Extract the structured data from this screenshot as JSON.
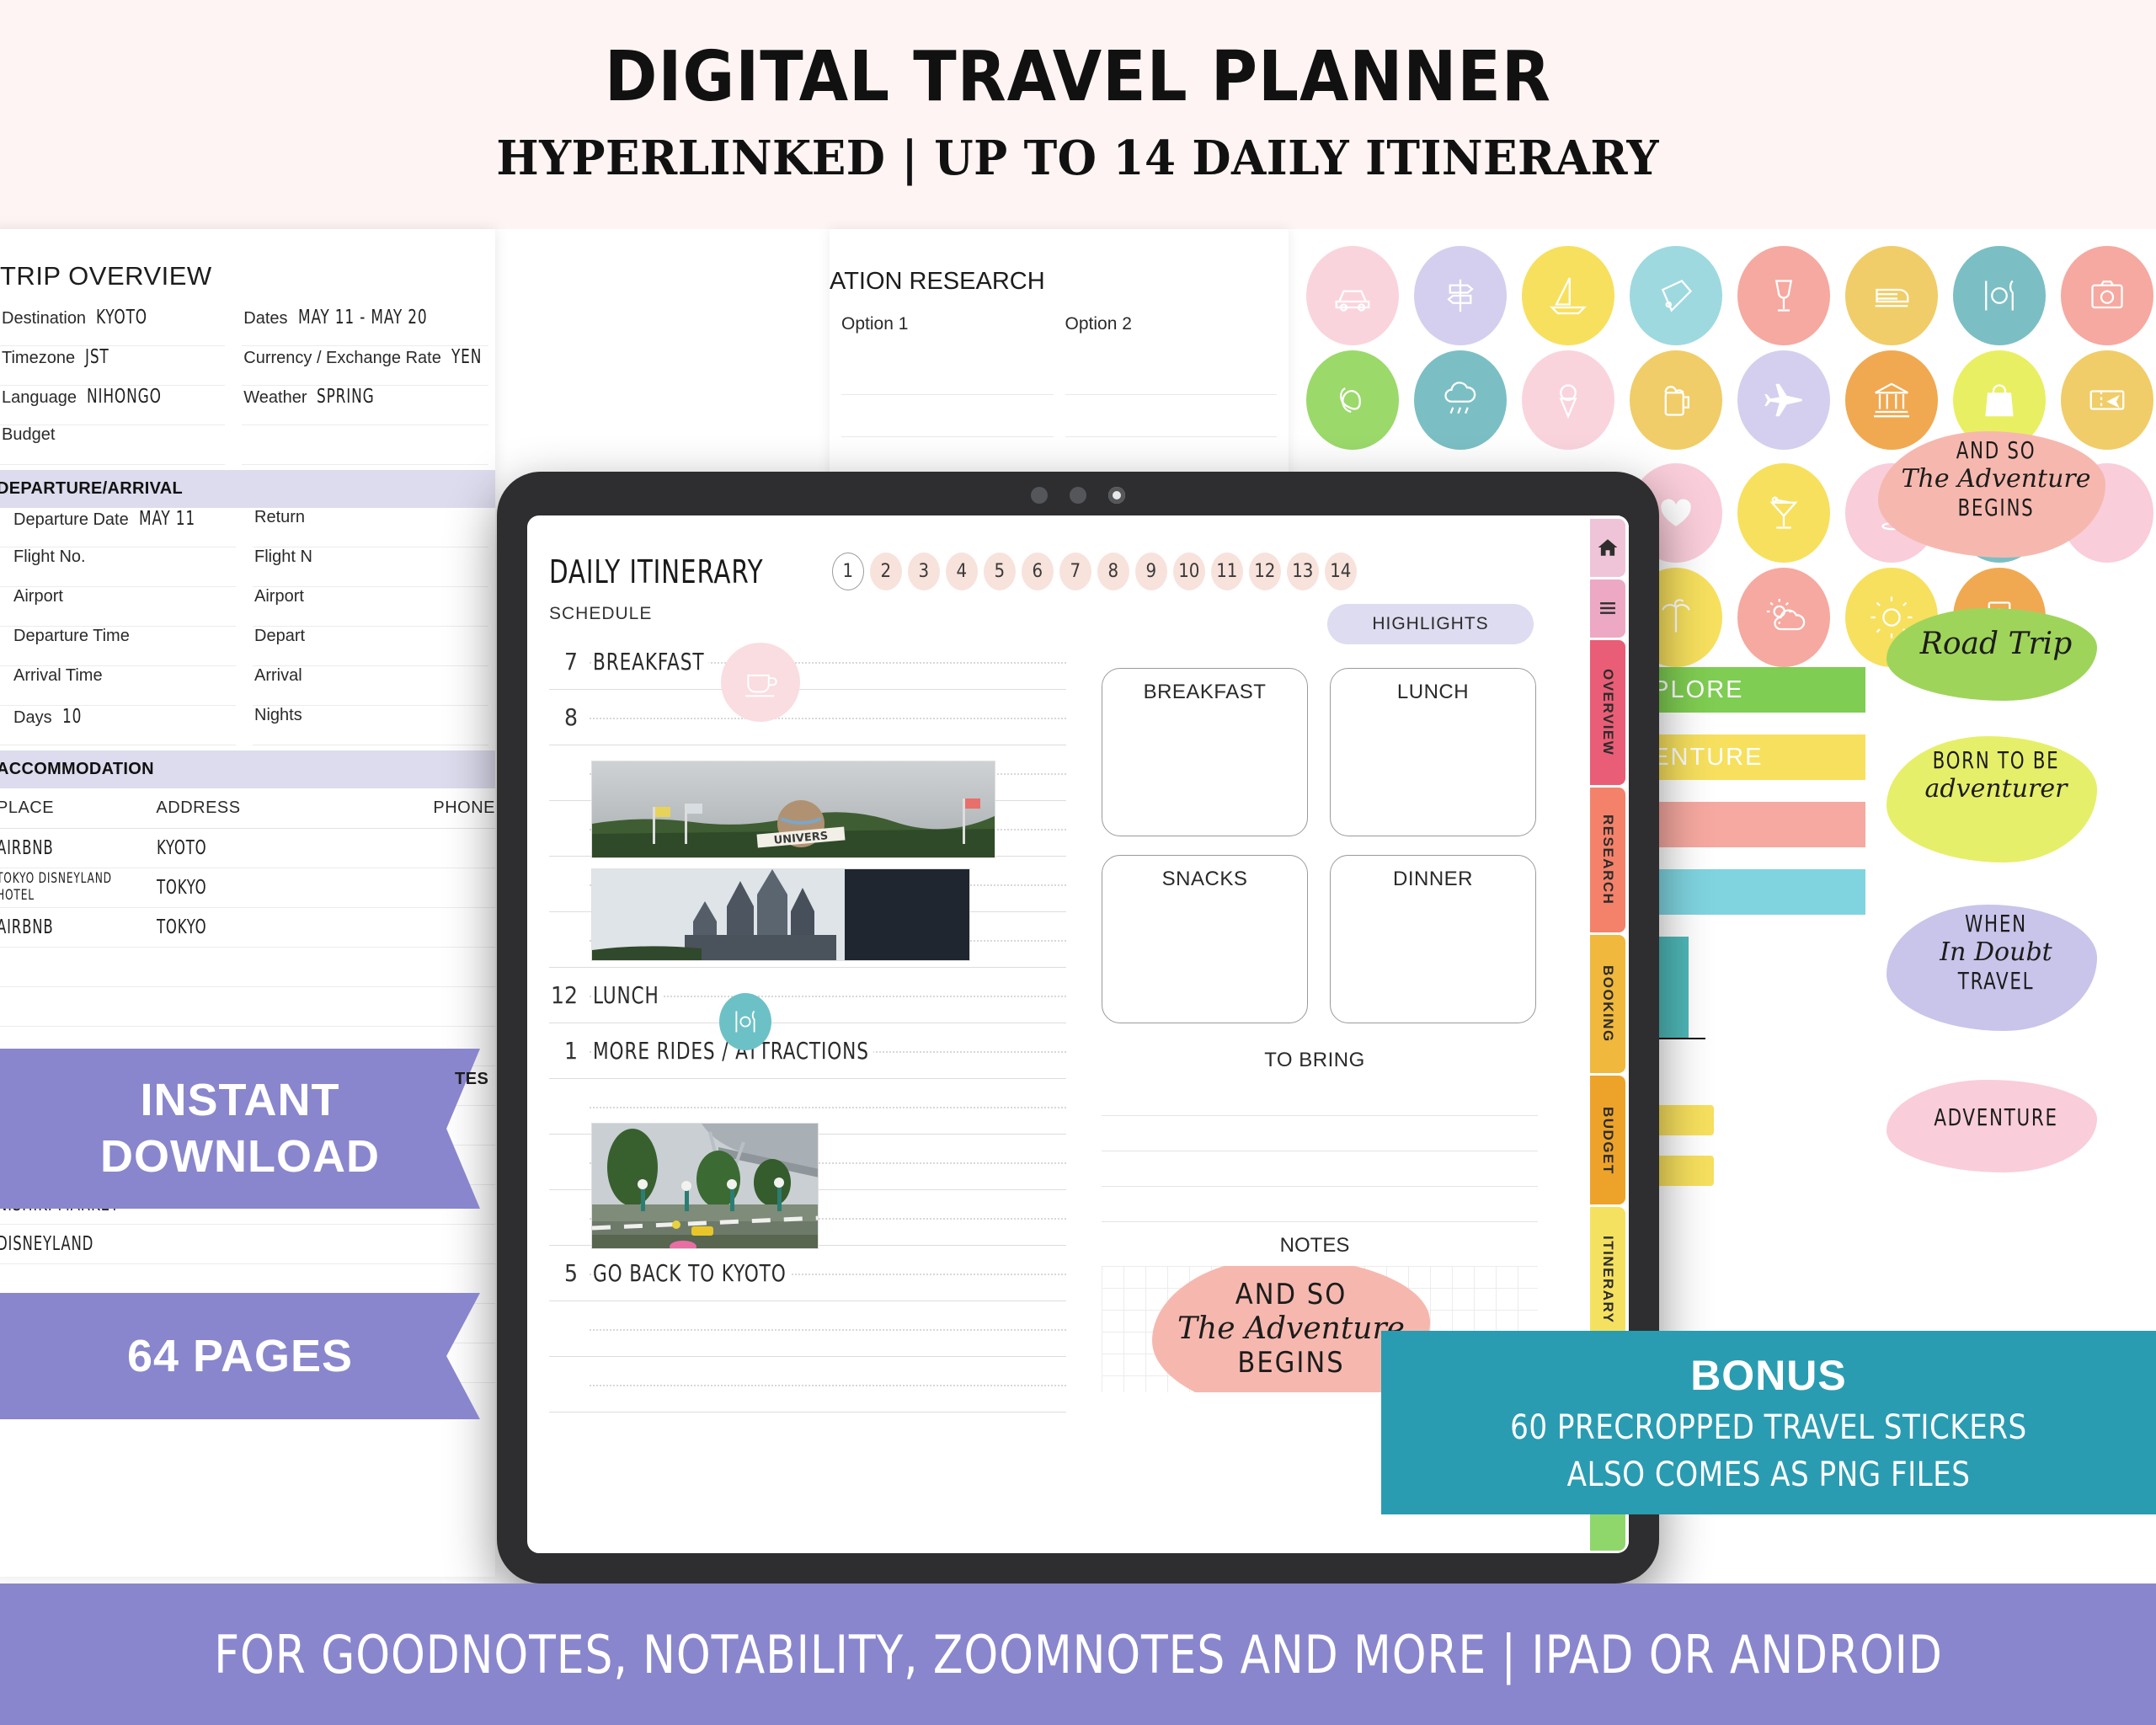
{
  "header": {
    "title": "DIGITAL TRAVEL PLANNER",
    "subtitle": "HYPERLINKED | UP TO 14 DAILY ITINERARY"
  },
  "trip_overview": {
    "title": "TRIP OVERVIEW",
    "left_fields": [
      {
        "label": "Destination",
        "value": "KYOTO"
      },
      {
        "label": "Timezone",
        "value": "JST"
      },
      {
        "label": "Language",
        "value": "NIHONGO"
      },
      {
        "label": "Budget",
        "value": ""
      }
    ],
    "right_fields": [
      {
        "label": "Dates",
        "value": "MAY 11 - MAY 20"
      },
      {
        "label": "Currency / Exchange Rate",
        "value": "YEN"
      },
      {
        "label": "Weather",
        "value": "SPRING"
      },
      {
        "label": "",
        "value": ""
      }
    ],
    "departure_section": "DEPARTURE/ARRIVAL",
    "departure_left": [
      {
        "label": "Departure Date",
        "value": "MAY 11"
      },
      {
        "label": "Flight No.",
        "value": ""
      },
      {
        "label": "Airport",
        "value": ""
      },
      {
        "label": "Departure Time",
        "value": ""
      },
      {
        "label": "Arrival Time",
        "value": ""
      },
      {
        "label": "Days",
        "value": "10"
      }
    ],
    "departure_right": [
      {
        "label": "Return",
        "value": ""
      },
      {
        "label": "Flight N",
        "value": ""
      },
      {
        "label": "Airport",
        "value": ""
      },
      {
        "label": "Depart",
        "value": ""
      },
      {
        "label": "Arrival",
        "value": ""
      },
      {
        "label": "Nights",
        "value": ""
      }
    ],
    "accommodation_section": "ACCOMMODATION",
    "accommodation_headers": [
      "PLACE",
      "ADDRESS",
      "PHONE"
    ],
    "accommodation_rows": [
      {
        "place": "AIRBNB",
        "address": "KYOTO",
        "phone": ""
      },
      {
        "place": "TOKYO DISNEYLAND HOTEL",
        "address": "TOKYO",
        "phone": ""
      },
      {
        "place": "AIRBNB",
        "address": "TOKYO",
        "phone": ""
      }
    ],
    "places_rows": [
      {
        "name": "NISHIKI MARKET"
      },
      {
        "name": "DISNEYLAND"
      }
    ],
    "notes_col_label": "TES"
  },
  "destination_research": {
    "title_visible": "ATION RESEARCH",
    "option1": "Option 1",
    "option2": "Option 2"
  },
  "tablet": {
    "page_title": "DAILY ITINERARY",
    "page_numbers": [
      "1",
      "2",
      "3",
      "4",
      "5",
      "6",
      "7",
      "8",
      "9",
      "10",
      "11",
      "12",
      "13",
      "14"
    ],
    "active_page": "1",
    "schedule_label": "SCHEDULE",
    "schedule_rows": [
      {
        "hour": "7",
        "text": "BREAKFAST",
        "sticker": "coffee-cup-icon"
      },
      {
        "hour": "8",
        "text": "",
        "sticker": ""
      },
      {
        "hour": "",
        "text": "",
        "sticker": ""
      },
      {
        "hour": "",
        "text": "",
        "sticker": ""
      },
      {
        "hour": "12",
        "text": "LUNCH",
        "sticker": "cutlery-icon"
      },
      {
        "hour": "1",
        "text": "MORE RIDES / ATTRACTIONS",
        "sticker": ""
      },
      {
        "hour": "",
        "text": "",
        "sticker": ""
      },
      {
        "hour": "",
        "text": "",
        "sticker": ""
      },
      {
        "hour": "5",
        "text": "GO BACK TO KYOTO",
        "sticker": ""
      },
      {
        "hour": "",
        "text": "",
        "sticker": ""
      },
      {
        "hour": "",
        "text": "",
        "sticker": ""
      }
    ],
    "highlights_pill": "HIGHLIGHTS",
    "meal_boxes": [
      "BREAKFAST",
      "LUNCH",
      "SNACKS",
      "DINNER"
    ],
    "to_bring_title": "TO BRING",
    "notes_title": "NOTES",
    "notes_quote": {
      "line1": "AND SO",
      "line2": "The Adventure",
      "line3": "BEGINS"
    },
    "side_tabs": [
      {
        "label": "",
        "icon": "home-icon",
        "color": "#f0c4d8"
      },
      {
        "label": "",
        "icon": "menu-icon",
        "color": "#eda8c4"
      },
      {
        "label": "OVERVIEW",
        "icon": "",
        "color": "#ea5d76"
      },
      {
        "label": "RESEARCH",
        "icon": "",
        "color": "#f4826a"
      },
      {
        "label": "BOOKING",
        "icon": "",
        "color": "#f0b83c"
      },
      {
        "label": "BUDGET",
        "icon": "",
        "color": "#eda32a"
      },
      {
        "label": "ITINERARY",
        "icon": "",
        "color": "#f5e160"
      },
      {
        "label": "",
        "icon": "",
        "color": "#cbe84b"
      },
      {
        "label": "",
        "icon": "",
        "color": "#8fd76b"
      }
    ]
  },
  "ribbons": {
    "instant_line1": "INSTANT",
    "instant_line2": "DOWNLOAD",
    "pages": "64 PAGES"
  },
  "bonus": {
    "title": "BONUS",
    "line2": "60 PRECROPPED TRAVEL STICKERS",
    "line3": "ALSO COMES AS PNG FILES"
  },
  "footer": {
    "text": "FOR  GOODNOTES, NOTABILITY, ZOOMNOTES AND MORE | IPAD OR ANDROID"
  },
  "stickers": {
    "dots": [
      {
        "icon": "car-icon",
        "color": "#fad4dd"
      },
      {
        "icon": "signpost-icon",
        "color": "#d4cfee"
      },
      {
        "icon": "sailboat-icon",
        "color": "#f7e05e"
      },
      {
        "icon": "ticket-icon",
        "color": "#9ed9e0"
      },
      {
        "icon": "wine-glass-icon",
        "color": "#f6a9a0"
      },
      {
        "icon": "train-icon",
        "color": "#f0cd68"
      },
      {
        "icon": "cutlery-icon",
        "color": "#7bbfc4"
      },
      {
        "icon": "camera-icon",
        "color": "#f6a9a0"
      },
      {
        "icon": "pretzel-icon",
        "color": "#9bd островов"
      },
      {
        "icon": "rain-cloud-icon",
        "color": "#7bbfc4"
      },
      {
        "icon": "ice-cream-icon",
        "color": "#fad4dd"
      },
      {
        "icon": "beer-mug-icon",
        "color": "#f0cd68"
      },
      {
        "icon": "airplane-icon",
        "color": "#d4cfee"
      },
      {
        "icon": "museum-icon",
        "color": "#f0a951"
      },
      {
        "icon": "shopping-bag-icon",
        "color": "#e9ef62"
      },
      {
        "icon": "boarding-pass-icon",
        "color": "#f0cd68"
      },
      {
        "icon": "cocktail-icon",
        "color": "#f7e05e"
      },
      {
        "icon": "map-pin-icon",
        "color": "#f9cdda"
      },
      {
        "icon": "skier-icon",
        "color": "#7bbfc4"
      },
      {
        "icon": "blank-icon",
        "color": "#f9cdda"
      },
      {
        "icon": "sun-cloud-icon",
        "color": "#f6a9a0"
      },
      {
        "icon": "sun-icon",
        "color": "#f7e05e"
      },
      {
        "icon": "passport-icon",
        "color": "#f0a951"
      }
    ],
    "tapes": [
      "#f9cdda",
      "#9ed9e0",
      "#d4cfee",
      "#fad4dd",
      "#d4cfee"
    ],
    "washi": [
      {
        "label": "EXPLORE",
        "color": "#7fcd52",
        "flag": false
      },
      {
        "label": "ADVENTURE",
        "color": "#f7e05e",
        "flag": false
      },
      {
        "label": "",
        "color": "#f6a9a0",
        "flag": true
      },
      {
        "label": "",
        "color": "#7fd4e0",
        "flag": true
      },
      {
        "label": "",
        "color": "#4fb8b8",
        "flag": false
      }
    ],
    "quotes": [
      {
        "l1": "AND SO",
        "l2": "The Adventure",
        "l3": "BEGINS",
        "color": "#f6b8ae"
      },
      {
        "l1": "",
        "l2": "Road Trip",
        "l3": "",
        "color": "#9fd45a"
      },
      {
        "l1": "BORN TO BE",
        "l2": "adventurer",
        "l3": "",
        "color": "#e6ef6a"
      },
      {
        "l1": "WHEN",
        "l2": "In Doubt",
        "l3": "TRAVEL",
        "color": "#c9c4ea"
      },
      {
        "l1": "",
        "l2": "",
        "l3": "ADVENTURE",
        "color": "#f9cdda"
      }
    ]
  }
}
